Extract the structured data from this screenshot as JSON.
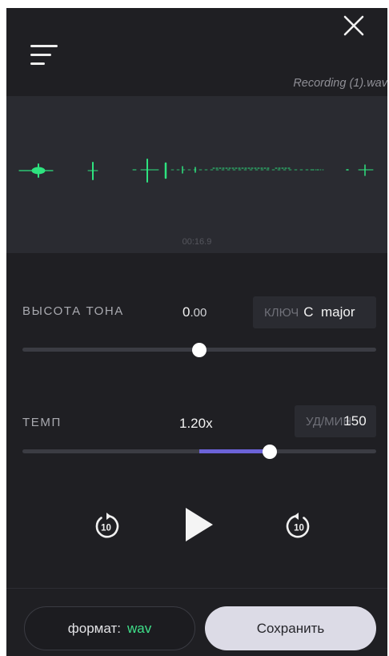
{
  "header": {
    "filename": "Recording (1).wav",
    "menu_icon": "hamburger-menu-icon",
    "close_icon": "close-x-icon"
  },
  "waveform": {
    "timestamp": "00:16.9",
    "color": "#2ee37f"
  },
  "pitch": {
    "label": "ВЫСОТА ТОНА",
    "value_main": "0",
    "value_dec": ".00",
    "key_label": "КЛЮЧ",
    "key_value": "C  major",
    "slider_fraction": 0.5
  },
  "tempo": {
    "label": "ТЕМП",
    "value": "1.20x",
    "bpm_label": "УД/МИН",
    "bpm_value": "150",
    "slider_fraction": 0.7
  },
  "transport": {
    "rewind_seconds": "10",
    "forward_seconds": "10",
    "rewind_icon": "rewind-10-icon",
    "play_icon": "play-icon",
    "forward_icon": "forward-10-icon"
  },
  "footer": {
    "format_label": "формат:",
    "format_value": "wav",
    "save_label": "Сохранить"
  },
  "colors": {
    "accent_green": "#3fe08a",
    "slider_fill": "#6c63d8",
    "background": "#1f1f23"
  }
}
